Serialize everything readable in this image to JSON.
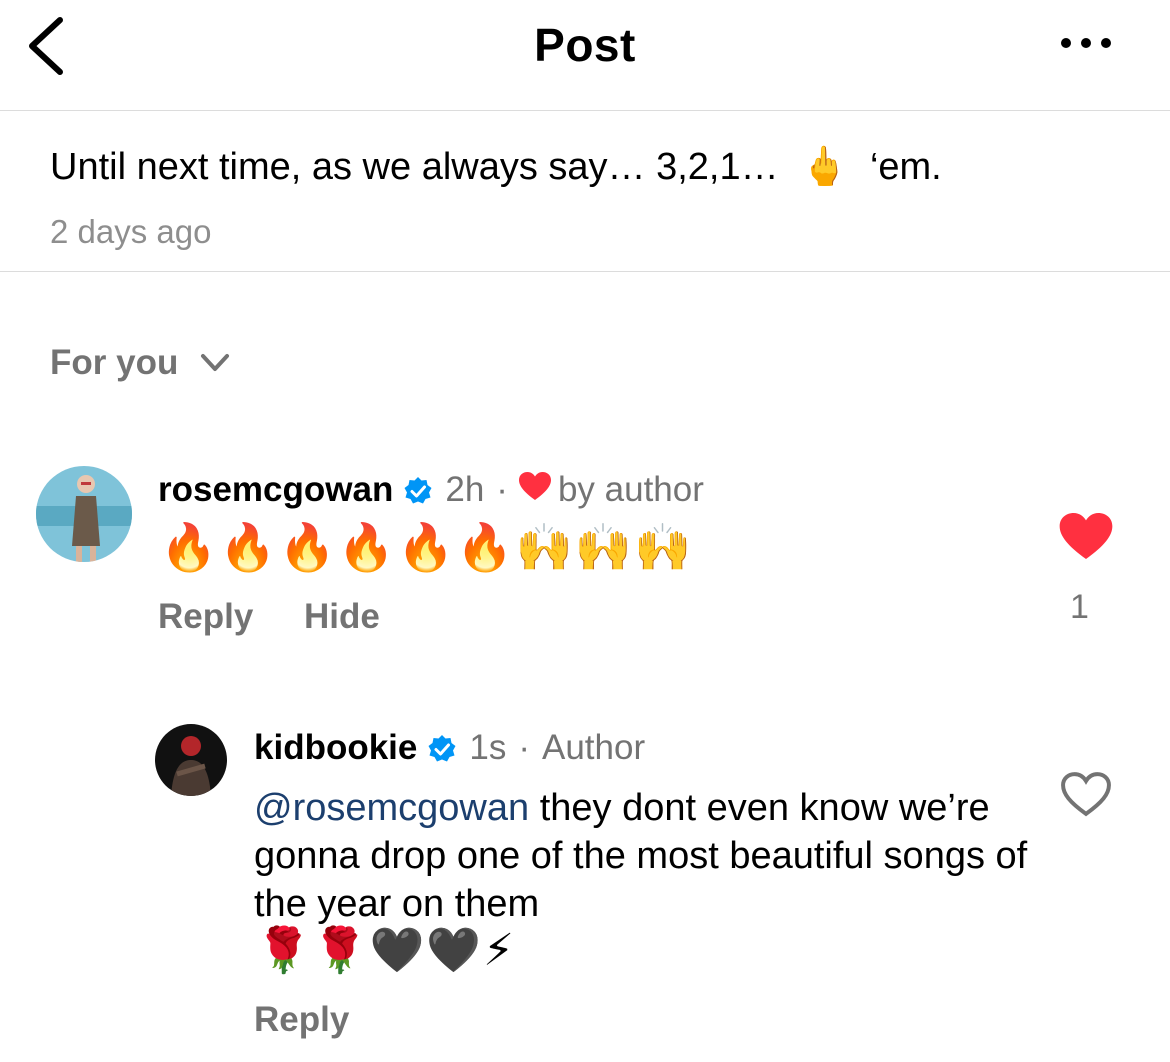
{
  "header": {
    "title": "Post",
    "back_icon": "chevron-left-icon",
    "more_icon": "more-horizontal-icon"
  },
  "caption": {
    "text_before": "Until next time, as we always say… 3,2,1…",
    "emoji": "🖕",
    "text_after": "‘em.",
    "timestamp": "2 days ago"
  },
  "sort": {
    "label": "For you",
    "icon": "chevron-down-icon"
  },
  "comments": [
    {
      "username": "rosemcgowan",
      "verified": true,
      "time": "2h",
      "separator": "·",
      "liked_by_author_label": "by author",
      "text": "🔥🔥🔥🔥🔥🔥🙌🙌🙌",
      "reply_label": "Reply",
      "hide_label": "Hide",
      "like_count": "1",
      "liked": true
    },
    {
      "username": "kidbookie",
      "verified": true,
      "time": "1s",
      "separator": "·",
      "role": "Author",
      "mention": "@rosemcgowan",
      "text": "they dont even know we’re gonna drop one of the most beautiful songs of the year on them",
      "emojis": "🌹🌹🖤🖤⚡",
      "reply_label": "Reply",
      "liked": false
    }
  ],
  "colors": {
    "like_red": "#ff3040",
    "verified_blue": "#0095f6",
    "mention_blue": "#1c3f6e",
    "secondary_gray": "#737373"
  }
}
